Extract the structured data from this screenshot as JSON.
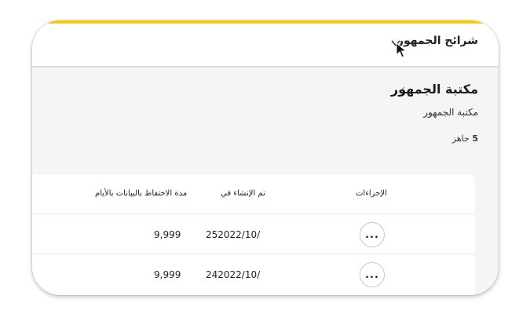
{
  "header": {
    "title": "شرائح الجمهور"
  },
  "page": {
    "title": "مكتبة الجمهور",
    "subtitle": "مكتبة الجمهور",
    "ready_count": "5",
    "ready_label": "جاهز"
  },
  "table": {
    "columns": {
      "actions": "الإجراءات",
      "created": "تم الإنشاء في",
      "retention": "مدة الاحتفاظ بالبيانات بالأيام"
    },
    "rows": [
      {
        "created": "252022/10/",
        "retention": "9,999",
        "actions_label": "..."
      },
      {
        "created": "242022/10/",
        "retention": "9,999",
        "actions_label": "..."
      }
    ]
  },
  "icons": {
    "topbar_chevron": "chevron-down-icon",
    "back_chevron": "chevron-left-icon",
    "cursor": "mouse-pointer-icon",
    "more": "more-horizontal-icon"
  },
  "colors": {
    "accent": "#f2c811",
    "background": "#f5f5f6",
    "surface": "#ffffff"
  }
}
